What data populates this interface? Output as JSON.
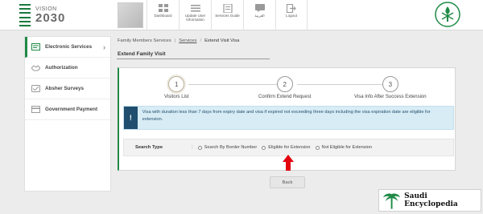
{
  "header": {
    "brand": {
      "top": "VISION",
      "year": "2030",
      "arabic": ""
    },
    "nav": [
      {
        "label": "Dashboard",
        "icon": "dashboard-icon"
      },
      {
        "label": "Update User Information",
        "icon": "user-info-icon"
      },
      {
        "label": "Services Guide",
        "icon": "services-guide-icon"
      },
      {
        "label": "العربية",
        "icon": "language-icon"
      },
      {
        "label": "Logout",
        "icon": "logout-icon"
      }
    ]
  },
  "sidebar": {
    "items": [
      {
        "label": "Electronic Services",
        "icon": "electronic-services-icon",
        "active": true
      },
      {
        "label": "Authorization",
        "icon": "authorization-icon"
      },
      {
        "label": "Absher Surveys",
        "icon": "surveys-icon"
      },
      {
        "label": "Government Payment",
        "icon": "payment-icon"
      }
    ]
  },
  "breadcrumb": {
    "root": "Family Members Services",
    "parent": "Services",
    "current": "Extend Visit Visa"
  },
  "page": {
    "title": "Extend Family Visit"
  },
  "steps": [
    {
      "number": "1",
      "label": "Visitors List",
      "current": true
    },
    {
      "number": "2",
      "label": "Confirm Extend Request"
    },
    {
      "number": "3",
      "label": "Visa Info After Success Extension"
    }
  ],
  "alert": {
    "icon_text": "!",
    "text": "Visa with duration less than 7 days from expiry date and visa if expired not exceeding three days including the visa expiration date are eligible for extension."
  },
  "search": {
    "label": "Search Type",
    "colon": ":",
    "options": [
      "Search By Border Number",
      "Eligible for Extension",
      "Not Eligible for Extension"
    ]
  },
  "buttons": {
    "back": "Back"
  },
  "watermark": {
    "text": "Saudi Encyclopedia"
  },
  "colors": {
    "accent_green": "#1e8a46",
    "alert_bg": "#d8ecf5",
    "alert_icon_bg": "#1f4e6e",
    "arrow_red": "#e3000f"
  }
}
